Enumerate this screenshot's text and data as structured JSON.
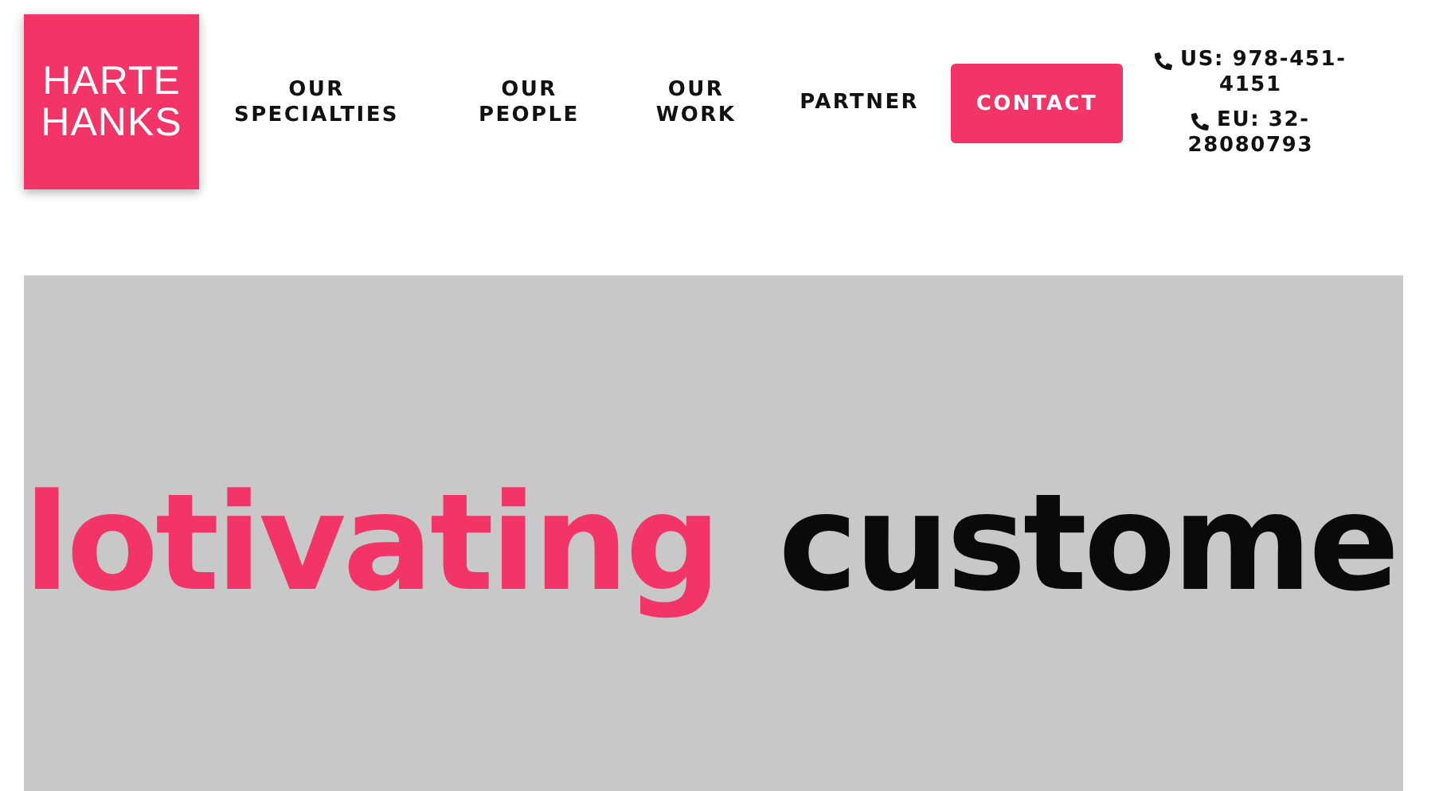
{
  "logo": {
    "lines": [
      "HARTE",
      "HANKS"
    ]
  },
  "nav": [
    {
      "lines": [
        "OUR",
        "SPECIALTIES"
      ]
    },
    {
      "lines": [
        "OUR",
        "PEOPLE"
      ]
    },
    {
      "lines": [
        "OUR",
        "WORK"
      ]
    },
    {
      "lines": [
        "PARTNER"
      ]
    }
  ],
  "contact_button": "CONTACT",
  "phones": [
    {
      "lines": [
        "US: 978-451-",
        "4151"
      ]
    },
    {
      "lines": [
        "EU: 32-",
        "28080793"
      ]
    }
  ],
  "hero": {
    "words": [
      {
        "text": "lotivating",
        "kind": "accent"
      },
      {
        "text": "custome",
        "kind": "plain"
      }
    ]
  }
}
